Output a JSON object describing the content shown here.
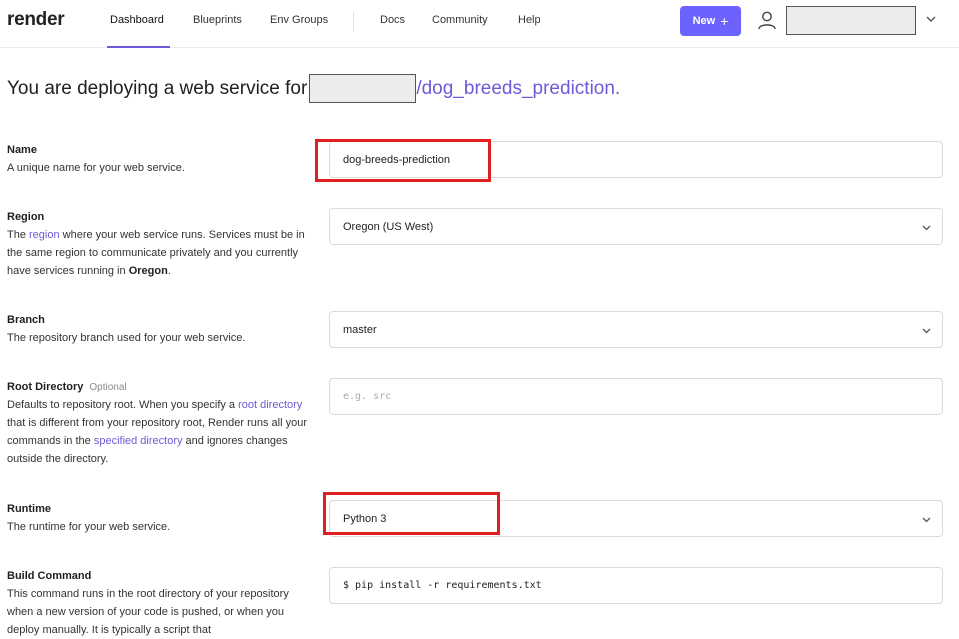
{
  "nav": {
    "logo": "render",
    "links": [
      "Dashboard",
      "Blueprints",
      "Env Groups",
      "Docs",
      "Community",
      "Help"
    ],
    "new_label": "New",
    "new_plus": "+"
  },
  "header": {
    "prefix": "You are deploying a web service for",
    "repo": "/dog_breeds_prediction."
  },
  "form": {
    "name": {
      "label": "Name",
      "desc": "A unique name for your web service.",
      "value": "dog-breeds-prediction"
    },
    "region": {
      "label": "Region",
      "desc_1": "The ",
      "desc_link": "region",
      "desc_2": " where your web service runs. Services must be in the same region to communicate privately and you currently have services running in ",
      "desc_bold": "Oregon",
      "desc_3": ".",
      "value": "Oregon (US West)"
    },
    "branch": {
      "label": "Branch",
      "desc": "The repository branch used for your web service.",
      "value": "master"
    },
    "root_dir": {
      "label": "Root Directory",
      "optional": "Optional",
      "desc_1": "Defaults to repository root. When you specify a ",
      "desc_link1": "root directory",
      "desc_2": " that is different from your repository root, Render runs all your commands in the ",
      "desc_link2": "specified directory",
      "desc_3": " and ignores changes outside the directory.",
      "placeholder": "e.g. src"
    },
    "runtime": {
      "label": "Runtime",
      "desc": "The runtime for your web service.",
      "value": "Python 3"
    },
    "build": {
      "label": "Build Command",
      "desc": "This command runs in the root directory of your repository when a new version of your code is pushed, or when you deploy manually. It is typically a script that",
      "value": "$ pip install -r requirements.txt"
    }
  },
  "colors": {
    "accent": "#6c5bd9",
    "button": "#6c63ff",
    "highlight": "#e02020"
  }
}
